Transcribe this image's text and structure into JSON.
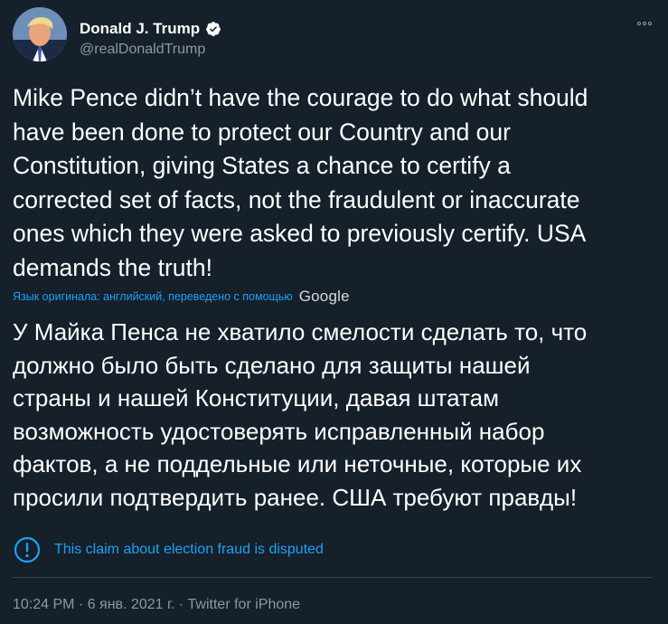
{
  "author": {
    "name": "Donald J. Trump",
    "handle": "@realDonaldTrump"
  },
  "tweet": {
    "lines": [
      "Mike Pence didn’t have the courage to do what should",
      "have been done to protect our Country and our",
      "Constitution, giving States a chance to certify a",
      "corrected set of facts, not the fraudulent or inaccurate",
      "ones which they were asked to previously certify. USA",
      "demands the truth!"
    ]
  },
  "translation": {
    "note": "Язык оригинала: английский, переведено с помощью",
    "provider": "Google",
    "lines": [
      "У Майка Пенса не хватило смелости сделать то, что",
      "должно было быть сделано для защиты нашей",
      "страны и нашей Конституции, давая штатам",
      "возможность удостоверять исправленный набор",
      "фактов, а не поддельные или неточные, которые их",
      "просили подтвердить ранее. США требуют правды!"
    ]
  },
  "dispute": {
    "label": "This claim about election fraud is disputed"
  },
  "meta": {
    "time": "10:24 PM",
    "sep1": " · ",
    "date": "6 янв. 2021 г.",
    "sep2": " · ",
    "source": "Twitter for iPhone"
  },
  "colors": {
    "background": "#15202b",
    "link": "#1da1f2",
    "secondary": "#8899a6"
  },
  "icons": {
    "more": "more-icon",
    "verified": "verified-badge-icon",
    "dispute": "exclamation-circle-icon"
  }
}
